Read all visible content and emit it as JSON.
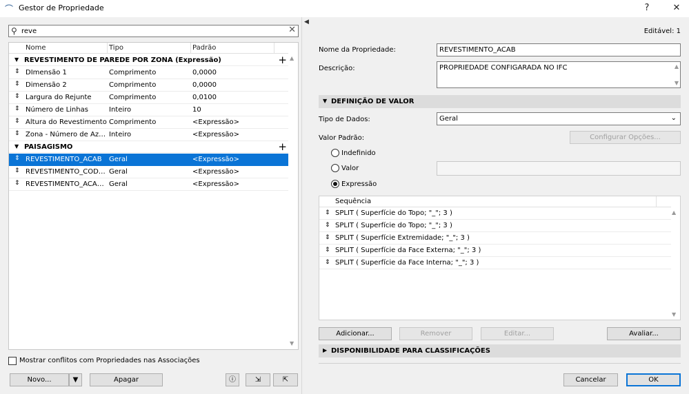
{
  "window": {
    "title": "Gestor de Propriedade",
    "help": "?",
    "close": "✕"
  },
  "search": {
    "value": "reve",
    "placeholder": ""
  },
  "tree": {
    "columns": [
      "Nome",
      "Tipo",
      "Padrão"
    ],
    "groups": [
      {
        "name": "REVESTIMENTO DE PAREDE POR ZONA (Expressão)",
        "rows": [
          {
            "name": "DImensão 1",
            "type": "Comprimento",
            "default": "0,0000"
          },
          {
            "name": "Dimensão 2",
            "type": "Comprimento",
            "default": "0,0000"
          },
          {
            "name": "Largura do Rejunte",
            "type": "Comprimento",
            "default": "0,0100"
          },
          {
            "name": "Número de Linhas",
            "type": "Inteiro",
            "default": "10"
          },
          {
            "name": "Altura do Revestimento",
            "type": "Comprimento",
            "default": "<Expressão>"
          },
          {
            "name": "Zona - Número de Azul...",
            "type": "Inteiro",
            "default": "<Expressão>"
          }
        ]
      },
      {
        "name": "PAISAGISMO",
        "rows": [
          {
            "name": "REVESTIMENTO_ACAB",
            "type": "Geral",
            "default": "<Expressão>",
            "selected": true
          },
          {
            "name": "REVESTIMENTO_CODIGO",
            "type": "Geral",
            "default": "<Expressão>"
          },
          {
            "name": "REVESTIMENTO_ACABA...",
            "type": "Geral",
            "default": "<Expressão>"
          }
        ]
      }
    ]
  },
  "left_bottom": {
    "checkbox_label": "Mostrar conflitos com Propriedades nas Associações",
    "new_button": "Novo...",
    "delete_button": "Apagar"
  },
  "details": {
    "editable": "Editável: 1",
    "name_label": "Nome da Propriedade:",
    "name_value": "REVESTIMENTO_ACAB",
    "desc_label": "Descrição:",
    "desc_value": "PROPRIEDADE CONFIGARADA NO IFC",
    "value_section": "DEFINIÇÃO DE VALOR",
    "data_type_label": "Tipo de Dados:",
    "data_type_value": "Geral",
    "default_label": "Valor Padrão:",
    "configure_button": "Configurar Opções...",
    "radio_undefined": "Indefinido",
    "radio_value": "Valor",
    "radio_expression": "Expressão",
    "sequence_header": "Sequência",
    "sequence": [
      "SPLIT ( Superfície do Topo; \"_\"; 3 )",
      "SPLIT ( Superfície do Topo; \"_\"; 3 )",
      "SPLIT ( Superfície Extremidade; \"_\"; 3 )",
      "SPLIT ( Superfície da Face Externa; \"_\"; 3 )",
      "SPLIT ( Superfície da Face Interna; \"_\"; 3 )"
    ],
    "add_button": "Adicionar...",
    "remove_button": "Remover",
    "edit_button": "Editar...",
    "evaluate_button": "Avaliar...",
    "classification_section": "DISPONIBILIDADE PARA CLASSIFICAÇÕES",
    "cancel_button": "Cancelar",
    "ok_button": "OK"
  },
  "colors": {
    "selection": "#0a74d6",
    "panel": "#f0f0f0",
    "section": "#dcdcdc"
  }
}
